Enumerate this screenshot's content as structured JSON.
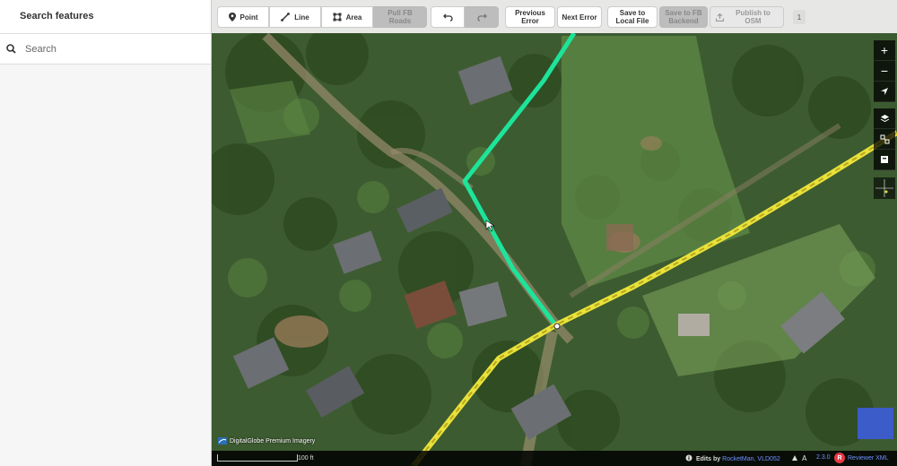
{
  "sidebar": {
    "title": "Search features",
    "search_placeholder": "Search"
  },
  "toolbar": {
    "modes": [
      {
        "label": "Point",
        "icon": "point-icon"
      },
      {
        "label": "Line",
        "icon": "line-icon"
      },
      {
        "label": "Area",
        "icon": "area-icon"
      }
    ],
    "pull_fb_roads": "Pull FB Roads",
    "undo_icon": "undo-icon",
    "redo_icon": "redo-icon",
    "previous_error": "Previous Error",
    "next_error": "Next Error",
    "save_local": "Save to Local File",
    "save_fb": "Save to FB Backend",
    "publish": "Publish to OSM",
    "count": "1"
  },
  "map_controls": [
    "zoom-in-icon",
    "zoom-out-icon",
    "geolocate-icon",
    "layers-icon",
    "map-data-icon",
    "issues-icon"
  ],
  "footer": {
    "scale": "100 ft",
    "edits_prefix": "Edits by",
    "edits_users": "RocketMan, VLD052",
    "version": "2.3.0",
    "reviewer_badge": "R",
    "reviewer": "Reviewer XML"
  },
  "attribution": "DigitalGlobe Premium Imagery",
  "colors": {
    "selected_way": "#1de49a",
    "road": "#e8e23a",
    "link": "#7092ff"
  }
}
